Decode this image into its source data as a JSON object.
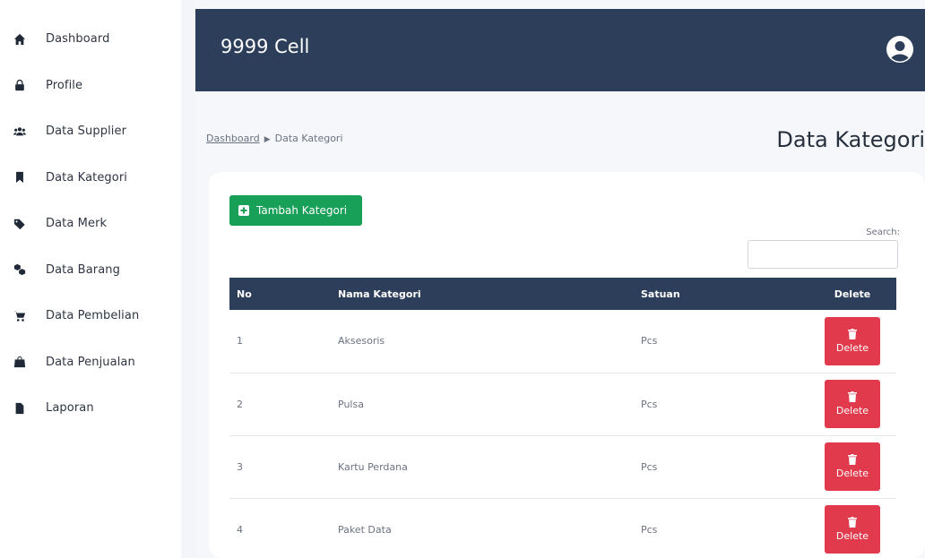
{
  "sidebar": {
    "items": [
      {
        "label": "Dashboard",
        "icon": "home-icon"
      },
      {
        "label": "Profile",
        "icon": "lock-icon"
      },
      {
        "label": "Data Supplier",
        "icon": "users-icon"
      },
      {
        "label": "Data Kategori",
        "icon": "bookmark-icon"
      },
      {
        "label": "Data Merk",
        "icon": "tag-icon"
      },
      {
        "label": "Data Barang",
        "icon": "cubes-icon"
      },
      {
        "label": "Data Pembelian",
        "icon": "cart-icon"
      },
      {
        "label": "Data Penjualan",
        "icon": "shopping-bag-icon"
      },
      {
        "label": "Laporan",
        "icon": "file-icon"
      }
    ]
  },
  "header": {
    "brand": "9999 Cell",
    "avatar_icon": "user-circle-icon"
  },
  "breadcrumb": {
    "home": "Dashboard",
    "current": "Data Kategori"
  },
  "page": {
    "title": "Data Kategori"
  },
  "actions": {
    "add_label": "Tambah Kategori"
  },
  "search": {
    "label": "Search:",
    "value": ""
  },
  "table": {
    "headers": [
      "No",
      "Nama Kategori",
      "Satuan",
      "Delete"
    ],
    "delete_label": "Delete",
    "rows": [
      {
        "no": "1",
        "nama": "Aksesoris",
        "satuan": "Pcs"
      },
      {
        "no": "2",
        "nama": "Pulsa",
        "satuan": "Pcs"
      },
      {
        "no": "3",
        "nama": "Kartu Perdana",
        "satuan": "Pcs"
      },
      {
        "no": "4",
        "nama": "Paket Data",
        "satuan": "Pcs"
      }
    ]
  },
  "colors": {
    "header_bg": "#2c3e5a",
    "add_button": "#18a058",
    "delete_button": "#e03a4c"
  }
}
